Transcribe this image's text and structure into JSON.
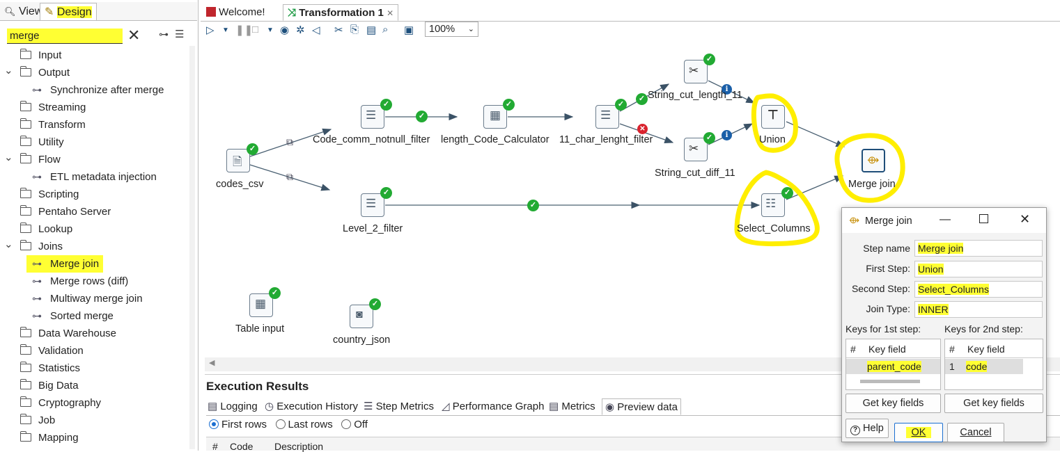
{
  "left_tabs": {
    "view": "View",
    "design": "Design"
  },
  "search": {
    "value": "merge"
  },
  "tree": [
    {
      "label": "Input",
      "type": "folder",
      "expanded": false
    },
    {
      "label": "Output",
      "type": "folder",
      "expanded": true
    },
    {
      "label": "Synchronize after merge",
      "type": "step"
    },
    {
      "label": "Streaming",
      "type": "folder",
      "expanded": false
    },
    {
      "label": "Transform",
      "type": "folder",
      "expanded": false
    },
    {
      "label": "Utility",
      "type": "folder",
      "expanded": false
    },
    {
      "label": "Flow",
      "type": "folder",
      "expanded": true
    },
    {
      "label": "ETL metadata injection",
      "type": "step"
    },
    {
      "label": "Scripting",
      "type": "folder",
      "expanded": false
    },
    {
      "label": "Pentaho Server",
      "type": "folder",
      "expanded": false
    },
    {
      "label": "Lookup",
      "type": "folder",
      "expanded": false
    },
    {
      "label": "Joins",
      "type": "folder",
      "expanded": true
    },
    {
      "label": "Merge join",
      "type": "step",
      "selected": true
    },
    {
      "label": "Merge rows (diff)",
      "type": "step"
    },
    {
      "label": "Multiway merge join",
      "type": "step"
    },
    {
      "label": "Sorted merge",
      "type": "step"
    },
    {
      "label": "Data Warehouse",
      "type": "folder",
      "expanded": false
    },
    {
      "label": "Validation",
      "type": "folder",
      "expanded": false
    },
    {
      "label": "Statistics",
      "type": "folder",
      "expanded": false
    },
    {
      "label": "Big Data",
      "type": "folder",
      "expanded": false
    },
    {
      "label": "Cryptography",
      "type": "folder",
      "expanded": false
    },
    {
      "label": "Job",
      "type": "folder",
      "expanded": false
    },
    {
      "label": "Mapping",
      "type": "folder",
      "expanded": false
    }
  ],
  "editor_tabs": {
    "welcome": "Welcome!",
    "transformation": "Transformation 1"
  },
  "toolbar": {
    "zoom": "100%"
  },
  "steps": {
    "codes_csv": "codes_csv",
    "code_comm_notnull_filter": "Code_comm_notnull_filter",
    "length_code_calculator": "length_Code_Calculator",
    "char_filter": "11_char_lenght_filter",
    "string_cut_length": "String_cut_length_11",
    "string_cut_diff": "String_cut_diff_11",
    "union": "Union",
    "merge_join": "Merge join",
    "level_2_filter": "Level_2_filter",
    "select_columns": "Select_Columns",
    "table_input": "Table input",
    "country_json": "country_json"
  },
  "results": {
    "title": "Execution Results",
    "tabs": [
      "Logging",
      "Execution History",
      "Step Metrics",
      "Performance Graph",
      "Metrics",
      "Preview data"
    ],
    "radios": [
      "First rows",
      "Last rows",
      "Off"
    ],
    "columns": [
      "#",
      "Code",
      "Description"
    ]
  },
  "dialog": {
    "title": "Merge join",
    "step_name_label": "Step name",
    "step_name": "Merge join",
    "first_step_label": "First Step:",
    "first_step": "Union",
    "second_step_label": "Second Step:",
    "second_step": "Select_Columns",
    "join_type_label": "Join Type:",
    "join_type": "INNER",
    "keys1_label": "Keys for 1st step:",
    "keys2_label": "Keys for 2nd step:",
    "col_hash": "#",
    "col_key": "Key field",
    "key1_value": "parent_code",
    "key2_index": "1",
    "key2_value": "code",
    "get_keys": "Get key fields",
    "help": "Help",
    "ok": "OK",
    "cancel": "Cancel"
  }
}
